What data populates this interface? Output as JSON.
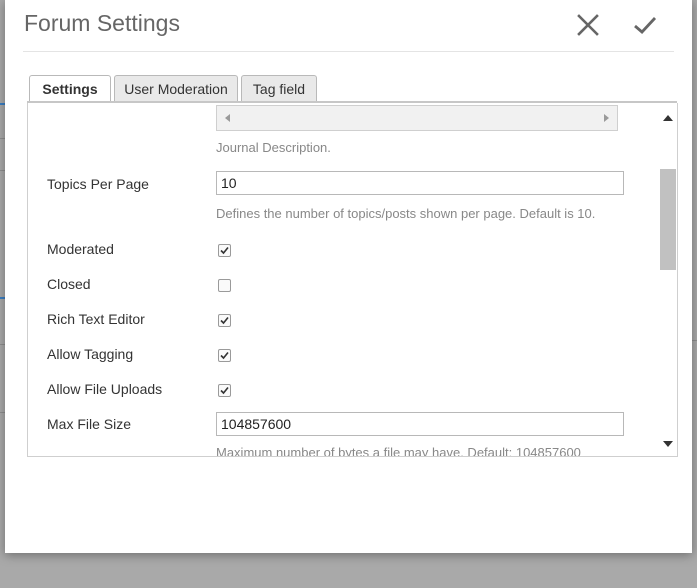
{
  "dialog": {
    "title": "Forum Settings",
    "close_icon": "close-icon",
    "confirm_icon": "checkmark-icon"
  },
  "tabs": [
    {
      "label": "Settings",
      "active": true
    },
    {
      "label": "User Moderation",
      "active": false
    },
    {
      "label": "Tag field",
      "active": false
    }
  ],
  "fields": {
    "journal_help": "Journal Description.",
    "topics_per_page": {
      "label": "Topics Per Page",
      "value": "10",
      "help": "Defines the number of topics/posts shown per page. Default is 10."
    },
    "moderated": {
      "label": "Moderated",
      "checked": true
    },
    "closed": {
      "label": "Closed",
      "checked": false
    },
    "rich_text_editor": {
      "label": "Rich Text Editor",
      "checked": true
    },
    "allow_tagging": {
      "label": "Allow Tagging",
      "checked": true
    },
    "allow_file_uploads": {
      "label": "Allow File Uploads",
      "checked": true
    },
    "max_file_size": {
      "label": "Max File Size",
      "value": "104857600",
      "help": "Maximum number of bytes a file may have. Default: 104857600"
    }
  },
  "colors": {
    "accent": "#3b7fc4",
    "overlay": "#a9a9a9"
  }
}
